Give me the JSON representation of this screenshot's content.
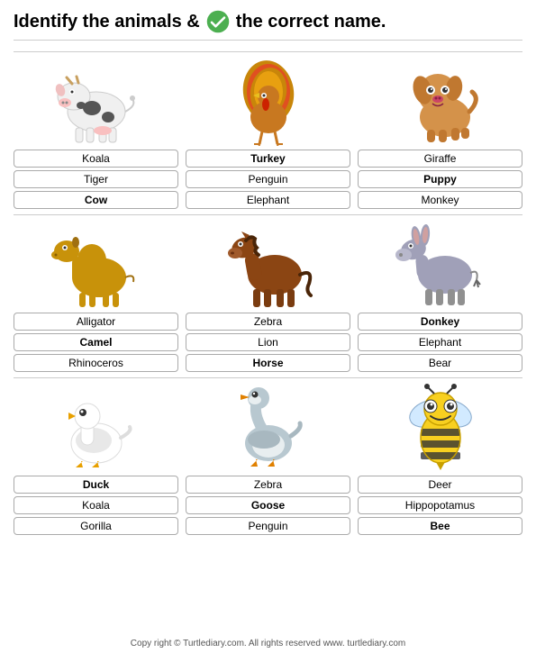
{
  "header": {
    "part1": "Identify the animals & ",
    "part2": " the correct name."
  },
  "sections": [
    {
      "animals": [
        {
          "name": "cow",
          "emoji": "🐄",
          "color": "#fff",
          "options": [
            "Koala",
            "Tiger",
            "Cow"
          ],
          "correct": "Cow"
        },
        {
          "name": "turkey",
          "emoji": "🦃",
          "color": "#fff",
          "options": [
            "Turkey",
            "Penguin",
            "Elephant"
          ],
          "correct": "Turkey"
        },
        {
          "name": "puppy",
          "emoji": "🐶",
          "color": "#fff",
          "options": [
            "Giraffe",
            "Puppy",
            "Monkey"
          ],
          "correct": "Puppy"
        }
      ]
    },
    {
      "animals": [
        {
          "name": "camel",
          "emoji": "🐪",
          "color": "#fff",
          "options": [
            "Alligator",
            "Camel",
            "Rhinoceros"
          ],
          "correct": "Camel"
        },
        {
          "name": "horse",
          "emoji": "🐴",
          "color": "#fff",
          "options": [
            "Zebra",
            "Lion",
            "Horse"
          ],
          "correct": "Horse"
        },
        {
          "name": "donkey",
          "emoji": "🫏",
          "color": "#fff",
          "options": [
            "Donkey",
            "Elephant",
            "Bear"
          ],
          "correct": "Donkey"
        }
      ]
    },
    {
      "animals": [
        {
          "name": "duck",
          "emoji": "🦆",
          "color": "#fff",
          "options": [
            "Duck",
            "Koala",
            "Gorilla"
          ],
          "correct": "Duck"
        },
        {
          "name": "goose",
          "emoji": "🪿",
          "color": "#fff",
          "options": [
            "Zebra",
            "Goose",
            "Penguin"
          ],
          "correct": "Goose"
        },
        {
          "name": "bee",
          "emoji": "🐝",
          "color": "#fff",
          "options": [
            "Deer",
            "Hippopotamus",
            "Bee"
          ],
          "correct": "Bee"
        }
      ]
    }
  ],
  "footer": "Copy right © Turtlediary.com. All rights reserved   www. turtlediary.com"
}
